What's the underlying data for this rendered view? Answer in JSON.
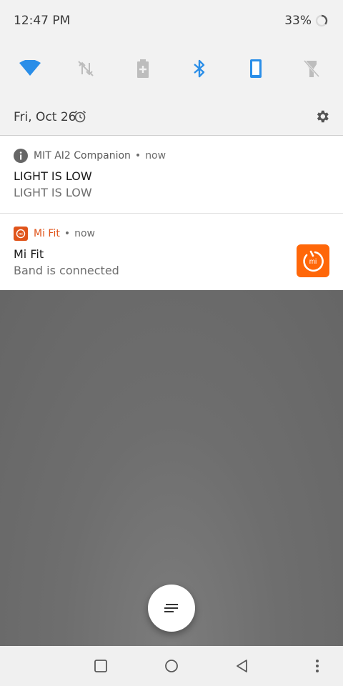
{
  "status_bar": {
    "time": "12:47 PM",
    "battery_percent": "33%",
    "battery_icon": "battery-charging-ring"
  },
  "quick_settings": {
    "tiles": [
      {
        "name": "wifi",
        "icon": "wifi-icon",
        "active": true
      },
      {
        "name": "mobile-data",
        "icon": "data-off-icon",
        "active": false
      },
      {
        "name": "battery-saver",
        "icon": "battery-plus-icon",
        "active": false
      },
      {
        "name": "bluetooth",
        "icon": "bluetooth-icon",
        "active": true
      },
      {
        "name": "rotation",
        "icon": "phone-portrait-icon",
        "active": true
      },
      {
        "name": "flashlight",
        "icon": "flashlight-off-icon",
        "active": false
      }
    ],
    "active_color": "#2a8ee8",
    "inactive_color": "#bdbdbd"
  },
  "header": {
    "date": "Fri, Oct 26",
    "alarm_icon": "alarm-icon",
    "settings_icon": "gear-icon"
  },
  "notifications": [
    {
      "app_name": "MIT AI2 Companion",
      "time": "now",
      "title": "LIGHT IS LOW",
      "text": "LIGHT IS LOW",
      "app_icon": "info-icon"
    },
    {
      "app_name": "Mi Fit",
      "time": "now",
      "title": "Mi Fit",
      "text": "Band is connected",
      "app_icon": "mi-fit-icon",
      "brand_color": "#ff6709"
    }
  ],
  "fab": {
    "icon": "manage-notifications-icon"
  },
  "nav_bar": {
    "buttons": [
      "recents-icon",
      "home-icon",
      "back-icon",
      "more-icon"
    ]
  }
}
